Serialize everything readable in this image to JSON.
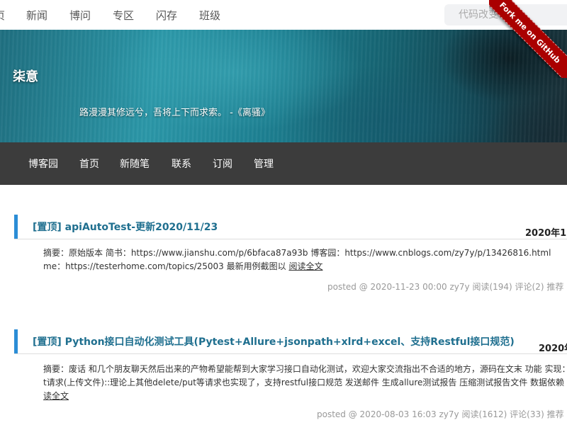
{
  "topnav": {
    "items": [
      "页",
      "新闻",
      "博问",
      "专区",
      "闪存",
      "班级"
    ],
    "search_placeholder": "代码改变世界"
  },
  "banner": {
    "blog_title": "柒意",
    "subtitle": "路漫漫其修远兮，吾将上下而求索。 -《离骚》",
    "ribbon_text": "Fork me on GitHub"
  },
  "blognav": {
    "items": [
      "博客园",
      "首页",
      "新随笔",
      "联系",
      "订阅",
      "管理"
    ]
  },
  "posts": [
    {
      "title": "[置顶] apiAutoTest-更新2020/11/23",
      "date": "2020年1",
      "summary_line1": "摘要：原始版本 简书：https://www.jianshu.com/p/6bfaca87a93b 博客园：https://www.cnblogs.com/zy7y/p/13426816.html",
      "summary_line2": "me：https://testerhome.com/topics/25003 最新用例截图以 ",
      "read_more": "阅读全文",
      "meta": "posted @ 2020-11-23 00:00 zy7y 阅读(194) 评论(2) 推荐"
    },
    {
      "title": "[置顶] Python接口自动化测试工具(Pytest+Allure+jsonpath+xlrd+excel、支持Restful接口规范)",
      "date": "2020年",
      "summary_line1": "摘要：废话 和几个朋友聊天然后出来的产物希望能帮到大家学习接口自动化测试，欢迎大家交流指出不合适的地方，源码在文末 功能 实现：",
      "summary_line2": "t请求(上传文件)::理论上其他delete/put等请求也实现了，支持restful接口规范 发送邮件 生成allure测试报告 压缩测试报告文件 数据依赖",
      "read_more": "读全文",
      "meta": "posted @ 2020-08-03 16:03 zy7y 阅读(1612) 评论(33) 推荐"
    }
  ]
}
